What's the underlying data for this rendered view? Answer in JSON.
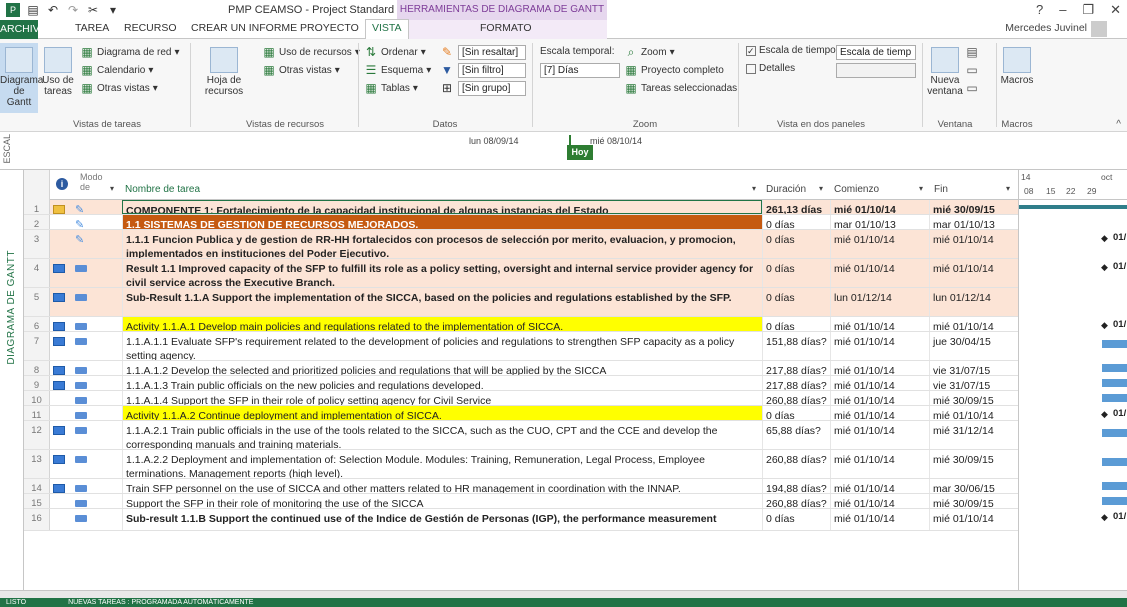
{
  "app": {
    "title": "PMP CEAMSO - Project Standard",
    "context_title": "HERRAMIENTAS DE DIAGRAMA DE GANTT",
    "user": "Mercedes Juvinel"
  },
  "tabs": {
    "archivo": "ARCHIVO",
    "tarea": "TAREA",
    "recurso": "RECURSO",
    "informe": "CREAR UN INFORME",
    "proyecto": "PROYECTO",
    "vista": "VISTA",
    "formato": "FORMATO"
  },
  "ribbon": {
    "diagrama_gantt": "Diagrama de Gantt",
    "uso_tareas": "Uso de tareas",
    "diagrama_red": "Diagrama de red",
    "calendario": "Calendario",
    "otras_vistas": "Otras vistas",
    "grp_vistas_tareas": "Vistas de tareas",
    "hoja_recursos": "Hoja de recursos",
    "uso_recursos": "Uso de recursos",
    "otras_vistas2": "Otras vistas",
    "grp_vistas_recursos": "Vistas de recursos",
    "ordenar": "Ordenar",
    "esquema": "Esquema",
    "tablas": "Tablas",
    "resaltar": "[Sin resaltar]",
    "filtro": "[Sin filtro]",
    "grupo": "[Sin grupo]",
    "grp_datos": "Datos",
    "escala_temporal": "Escala temporal:",
    "dias": "[7] Días",
    "zoom": "Zoom",
    "proyecto_completo": "Proyecto completo",
    "tareas_sel": "Tareas seleccionadas",
    "grp_zoom": "Zoom",
    "escala_tiempo": "Escala de tiempo",
    "escala_tiempo_sel": "Escala de tiemp",
    "detalles": "Detalles",
    "grp_paneles": "Vista en dos paneles",
    "nueva_ventana": "Nueva ventana",
    "grp_ventana": "Ventana",
    "macros": "Macros",
    "grp_macros": "Macros"
  },
  "timeline": {
    "label": "ESCAL",
    "lun": "lun 08/09/14",
    "mie": "mié 08/10/14",
    "hoy": "Hoy"
  },
  "side_label": "DIAGRAMA DE GANTT",
  "headers": {
    "modo": "Modo de",
    "nombre": "Nombre de tarea",
    "duracion": "Duración",
    "comienzo": "Comienzo",
    "fin": "Fin",
    "g_14": "14",
    "g_oct": "oct",
    "g_08": "08",
    "g_15": "15",
    "g_22": "22",
    "g_29": "29"
  },
  "rows": [
    {
      "n": "1",
      "name": "COMPONENTE 1: Fortalecimiento de la capacidad institucional de algunas instancias del Estado",
      "dur": "261,13 días",
      "start": "mié 01/10/14",
      "fin": "mié 30/09/15"
    },
    {
      "n": "2",
      "name": "1.1 SISTEMAS DE GESTION DE RECURSOS MEJORADOS.",
      "dur": "0 días",
      "start": "mar 01/10/13",
      "fin": "mar 01/10/13"
    },
    {
      "n": "3",
      "name": "1.1.1 Funcion Publica y  de gestion de RR-HH fortalecidos con procesos de selección por merito, evaluacion, y promocion, implementados en instituciones del Poder Ejecutivo.",
      "dur": "0 días",
      "start": "mié 01/10/14",
      "fin": "mié 01/10/14",
      "g": "01/"
    },
    {
      "n": "4",
      "name": "Result 1.1 Improved capacity of the SFP to fulfill its role as a policy setting, oversight and internal service provider agency for civil service across the Executive Branch.",
      "dur": "0 días",
      "start": "mié 01/10/14",
      "fin": "mié 01/10/14",
      "g": "01/"
    },
    {
      "n": "5",
      "name": "Sub-Result 1.1.A Support the implementation of the SICCA, based on the policies and regulations established by the SFP.",
      "dur": "0 días",
      "start": "lun 01/12/14",
      "fin": "lun 01/12/14"
    },
    {
      "n": "6",
      "name": "Activity 1.1.A.1 Develop main policies and regulations related to the implementation of SICCA.",
      "dur": "0 días",
      "start": "mié 01/10/14",
      "fin": "mié 01/10/14",
      "g": "01/"
    },
    {
      "n": "7",
      "name": "1.1.A.1.1 Evaluate SFP's requirement related to the development of policies and regulations to strengthen SFP capacity as a policy setting agency.",
      "dur": "151,88 días?",
      "start": "mié 01/10/14",
      "fin": "jue 30/04/15"
    },
    {
      "n": "8",
      "name": "1.1.A.1.2 Develop the selected and prioritized policies and regulations that will be applied by the SICCA",
      "dur": "217,88 días?",
      "start": "mié 01/10/14",
      "fin": "vie 31/07/15"
    },
    {
      "n": "9",
      "name": "1.1.A.1.3 Train public officials on the new policies and regulations developed.",
      "dur": "217,88 días?",
      "start": "mié 01/10/14",
      "fin": "vie 31/07/15"
    },
    {
      "n": "10",
      "name": "1.1.A.1.4 Support the SFP in their role of policy setting agency for Civil Service",
      "dur": "260,88 días?",
      "start": "mié 01/10/14",
      "fin": "mié 30/09/15"
    },
    {
      "n": "11",
      "name": "Activity 1.1.A.2 Continue deployment and implementation of SICCA.",
      "dur": "0 días",
      "start": "mié 01/10/14",
      "fin": "mié 01/10/14",
      "g": "01/"
    },
    {
      "n": "12",
      "name": "1.1.A.2.1 Train public officials in the use of the tools related to the SICCA, such as the CUO, CPT and the CCE and develop the corresponding manuals and training materials.",
      "dur": "65,88 días?",
      "start": "mié 01/10/14",
      "fin": "mié 31/12/14"
    },
    {
      "n": "13",
      "name": "1.1.A.2.2 Deployment and implementation of: Selection Module. Modules: Training, Remuneration, Legal Process, Employee terminations. Management reports (high level).",
      "dur": "260,88 días?",
      "start": "mié 01/10/14",
      "fin": "mié 30/09/15"
    },
    {
      "n": "14",
      "name": "Train SFP personnel on the use of SICCA and other matters related to HR management in coordination with the INNAP.",
      "dur": "194,88 días?",
      "start": "mié 01/10/14",
      "fin": "mar 30/06/15"
    },
    {
      "n": "15",
      "name": "Support the SFP in their role of monitoring the use of the SICCA",
      "dur": "260,88 días?",
      "start": "mié 01/10/14",
      "fin": "mié 30/09/15"
    },
    {
      "n": "16",
      "name": "Sub-result 1.1.B Support the continued use of the Indice de Gestión de Personas (IGP), the performance measurement",
      "dur": "0 días",
      "start": "mié 01/10/14",
      "fin": "mié 01/10/14",
      "g": "01/"
    }
  ],
  "status": {
    "listo": "LISTO",
    "nuevas": "NUEVAS TAREAS : PROGRAMADA AUTOMÁTICAMENTE"
  },
  "colors": {
    "accent": "#217346",
    "summary_bg": "#fce4d6",
    "orange_row": "#c55a11",
    "yellow_row": "#ffff00",
    "bar": "#5b9bd5",
    "summary_bar": "#2f7e8a"
  }
}
